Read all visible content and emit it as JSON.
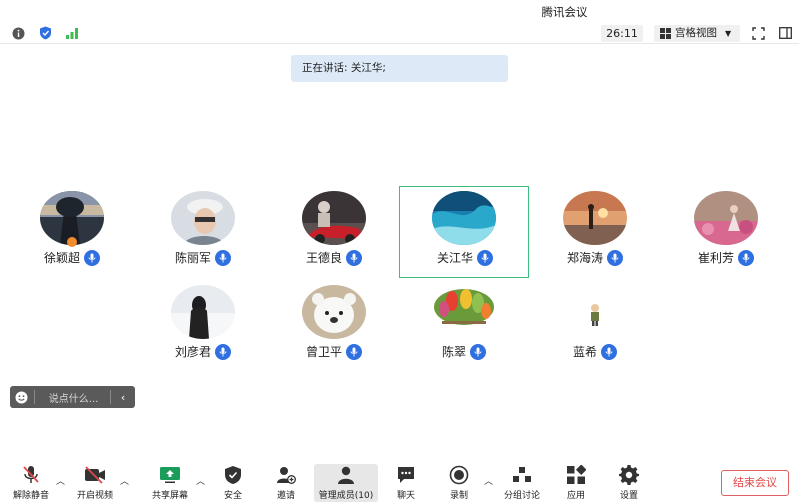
{
  "window": {
    "title": "腾讯会议"
  },
  "topbar": {
    "timer": "26:11",
    "view_label": "宫格视图"
  },
  "banner": {
    "speaking_text": "正在讲话: 关江华;"
  },
  "participants": [
    {
      "name": "徐颖超",
      "avatar": "sunset-tree-avatar",
      "host": true
    },
    {
      "name": "陈丽军",
      "avatar": "person-hat-avatar"
    },
    {
      "name": "王德良",
      "avatar": "red-car-avatar"
    },
    {
      "name": "关江华",
      "avatar": "sea-wave-avatar",
      "speaking": true
    },
    {
      "name": "郑海涛",
      "avatar": "sunset-beach-avatar"
    },
    {
      "name": "崔利芳",
      "avatar": "flower-field-avatar"
    },
    {
      "name": "刘彦君",
      "avatar": "snow-person-avatar"
    },
    {
      "name": "曾卫平",
      "avatar": "cartoon-bear-avatar"
    },
    {
      "name": "陈翠",
      "avatar": "fruit-avatar"
    },
    {
      "name": "蓝希",
      "avatar": "small-figure-avatar"
    }
  ],
  "chat": {
    "placeholder": "说点什么..."
  },
  "toolbar": {
    "unmute": "解除静音",
    "start_video": "开启视频",
    "share_screen": "共享屏幕",
    "security": "安全",
    "invite": "邀请",
    "manage_members": "管理成员(10)",
    "chat": "聊天",
    "record": "录制",
    "breakout": "分组讨论",
    "apps": "应用",
    "settings": "设置",
    "end_meeting": "结束会议"
  },
  "colors": {
    "accent": "#2f6fe0",
    "active_border": "#3dbd7d",
    "end": "#e04848",
    "banner": "#dde9f6"
  }
}
